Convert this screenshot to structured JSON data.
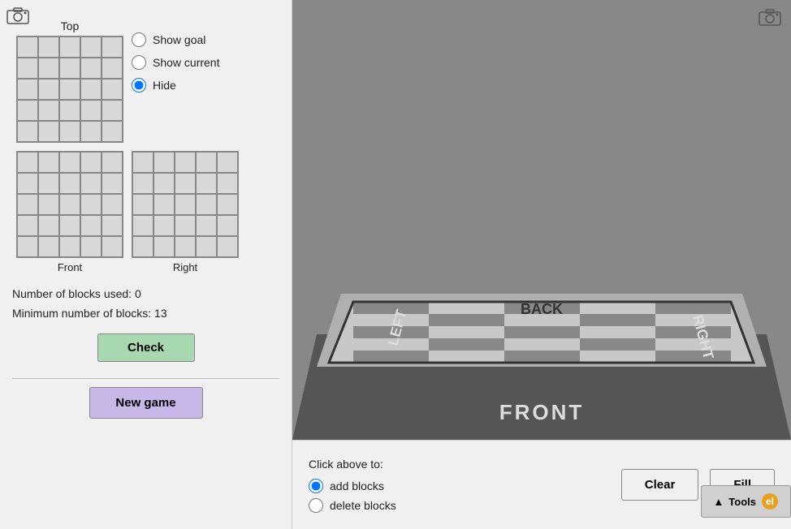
{
  "left_panel": {
    "top_label": "Top",
    "radio_options": {
      "show_goal": "Show goal",
      "show_current": "Show current",
      "hide": "Hide",
      "selected": "hide"
    },
    "bottom_grid_labels": {
      "front": "Front",
      "right": "Right"
    },
    "stats": {
      "blocks_used_label": "Number of blocks used: 0",
      "min_blocks_label": "Minimum number of blocks: 13"
    },
    "check_btn": "Check",
    "new_game_btn": "New game"
  },
  "right_panel": {
    "bottom_bar": {
      "click_label": "Click above to:",
      "add_blocks": "add blocks",
      "delete_blocks": "delete blocks",
      "selected": "add",
      "clear_btn": "Clear",
      "fill_btn": "Fill",
      "tools_btn": "Tools"
    }
  }
}
